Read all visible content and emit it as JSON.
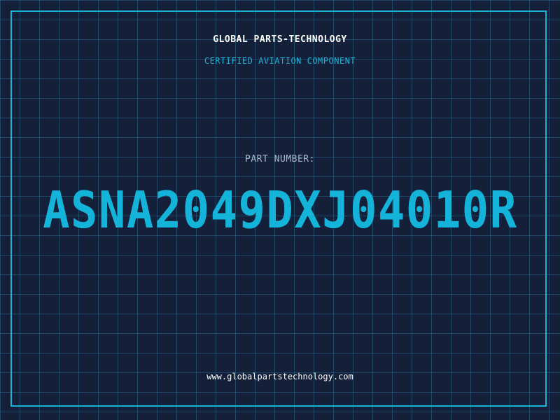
{
  "brand": {
    "title": "GLOBAL PARTS-TECHNOLOGY",
    "subtitle": "CERTIFIED AVIATION COMPONENT"
  },
  "part": {
    "label": "PART NUMBER:",
    "number": "ASNA2049DXJ04010R"
  },
  "footer": {
    "website": "www.globalpartstechnology.com"
  },
  "colors": {
    "background": "#14203a",
    "grid": "#286e8c",
    "accent": "#1ab2d6",
    "text_primary": "#ffffff",
    "text_muted": "#a7b6c8"
  }
}
